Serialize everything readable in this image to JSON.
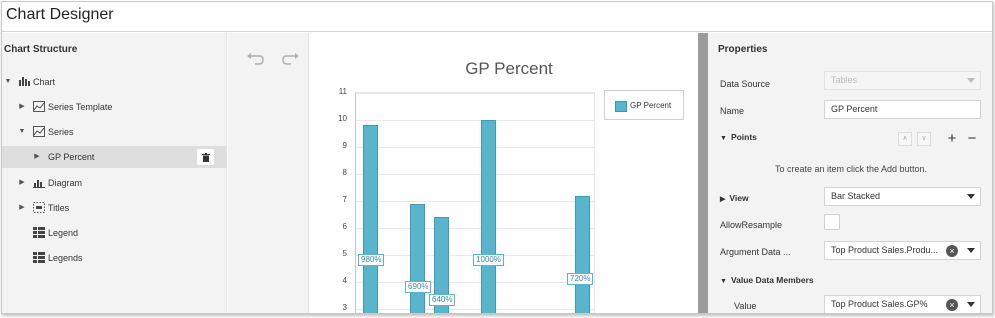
{
  "window": {
    "title": "Chart Designer"
  },
  "left_panel": {
    "title": "Chart Structure",
    "items": [
      {
        "label": "Chart"
      },
      {
        "label": "Series Template"
      },
      {
        "label": "Series"
      },
      {
        "label": "GP Percent"
      },
      {
        "label": "Diagram"
      },
      {
        "label": "Titles"
      },
      {
        "label": "Legend"
      },
      {
        "label": "Legends"
      }
    ]
  },
  "toolbar": {
    "undo_icon": "undo-icon",
    "redo_icon": "redo-icon"
  },
  "chart_data": {
    "type": "bar",
    "title": "GP Percent",
    "legend": {
      "placement": "top-right",
      "entries": [
        "GP Percent"
      ]
    },
    "series": [
      {
        "name": "GP Percent",
        "color": "#5ab4cc",
        "values": [
          9.8,
          6.9,
          6.4,
          10.0,
          7.2
        ],
        "labels": [
          "980%",
          "690%",
          "640%",
          "1000%",
          "720%"
        ]
      }
    ],
    "y_ticks": [
      "11",
      "10",
      "9",
      "8",
      "7",
      "6",
      "5",
      "4",
      "3"
    ],
    "ylim": [
      3,
      11
    ],
    "grid": true
  },
  "properties": {
    "title": "Properties",
    "data_source": {
      "label": "Data Source",
      "placeholder": "Tables"
    },
    "name": {
      "label": "Name",
      "value": "GP Percent"
    },
    "points": {
      "label": "Points"
    },
    "hint": "To create an item click the Add button.",
    "view": {
      "label": "View",
      "value": "Bar Stacked"
    },
    "allow_resample": {
      "label": "AllowResample"
    },
    "argument_data": {
      "label": "Argument Data ...",
      "value": "Top Product Sales.Produ..."
    },
    "value_data_members": {
      "label": "Value Data Members"
    },
    "value": {
      "label": "Value",
      "value": "Top Product Sales.GP%"
    }
  },
  "colors": {
    "accent": "#5ab4cc",
    "panel": "#f3f3f3",
    "separator": "#9a9a9a"
  }
}
